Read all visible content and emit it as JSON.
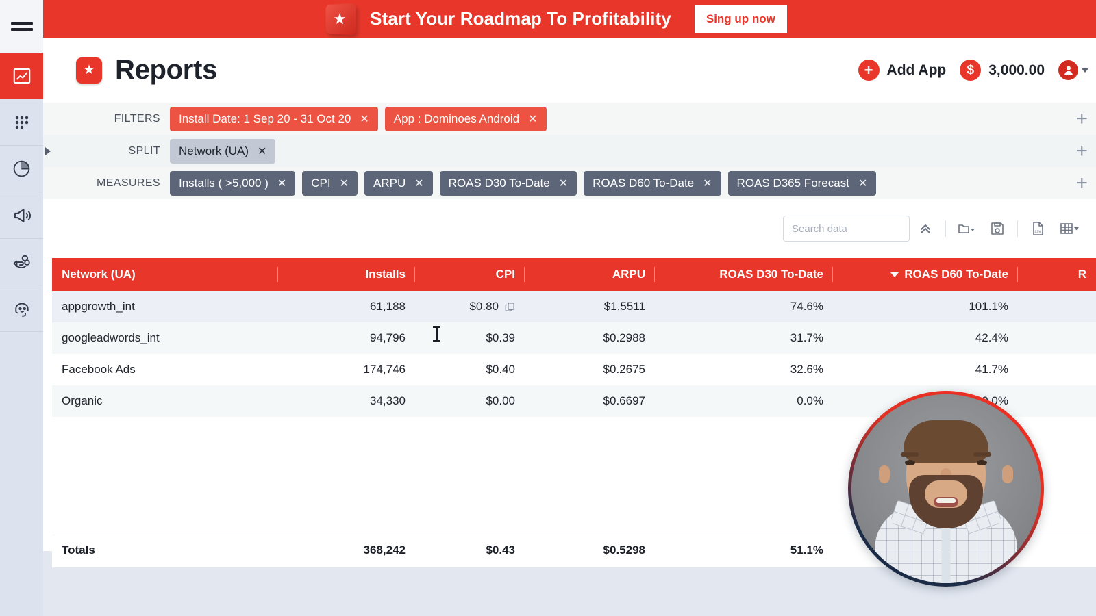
{
  "promo": {
    "text": "Start Your Roadmap To Profitability",
    "button": "Sing up now",
    "logo_icon": "star-icon"
  },
  "sidebar": {
    "menu_icon": "hamburger-icon",
    "items": [
      {
        "name": "reports",
        "icon": "line-chart-icon",
        "active": true
      },
      {
        "name": "apps",
        "icon": "grid-dots-icon",
        "active": false
      },
      {
        "name": "analytics",
        "icon": "pie-chart-icon",
        "active": false
      },
      {
        "name": "campaigns",
        "icon": "megaphone-icon",
        "active": false
      },
      {
        "name": "payouts",
        "icon": "hand-coin-icon",
        "active": false
      },
      {
        "name": "support",
        "icon": "headset-icon",
        "active": false
      }
    ]
  },
  "header": {
    "title": "Reports",
    "logo_icon": "star-icon",
    "add_app_label": "Add App",
    "add_app_icon": "plus-circle-icon",
    "balance": "3,000.00",
    "balance_icon": "dollar-circle-icon",
    "avatar_icon": "user-avatar-icon",
    "avatar_caret": "chevron-down-icon"
  },
  "filters": {
    "rows": [
      {
        "label": "FILTERS",
        "style": "red",
        "chips": [
          {
            "label": "Install Date: 1 Sep 20 - 31 Oct 20",
            "remove": "✕"
          },
          {
            "label": "App : Dominoes Android",
            "remove": "✕"
          }
        ],
        "add": "+"
      },
      {
        "label": "SPLIT",
        "style": "grey",
        "chips": [
          {
            "label": "Network (UA)",
            "remove": "✕"
          }
        ],
        "add": "+"
      },
      {
        "label": "MEASURES",
        "style": "slate",
        "chips": [
          {
            "label": "Installs ( >5,000 )",
            "remove": "✕"
          },
          {
            "label": "CPI",
            "remove": "✕"
          },
          {
            "label": "ARPU",
            "remove": "✕"
          },
          {
            "label": "ROAS D30 To-Date",
            "remove": "✕"
          },
          {
            "label": "ROAS D60 To-Date",
            "remove": "✕"
          },
          {
            "label": "ROAS D365 Forecast",
            "remove": "✕"
          }
        ],
        "add": "+"
      }
    ]
  },
  "toolbar": {
    "search_placeholder": "Search data",
    "search_value": "",
    "icons": [
      {
        "name": "collapse-up-icon"
      },
      {
        "name": "folder-dropdown-icon"
      },
      {
        "name": "save-icon"
      },
      {
        "name": "csv-export-icon"
      },
      {
        "name": "table-view-dropdown-icon"
      }
    ]
  },
  "table": {
    "columns": [
      {
        "key": "network",
        "label": "Network (UA)",
        "align": "left",
        "sorted": false
      },
      {
        "key": "installs",
        "label": "Installs",
        "align": "right",
        "sorted": false
      },
      {
        "key": "cpi",
        "label": "CPI",
        "align": "right",
        "sorted": false
      },
      {
        "key": "arpu",
        "label": "ARPU",
        "align": "right",
        "sorted": false
      },
      {
        "key": "roas_d30",
        "label": "ROAS D30 To-Date",
        "align": "right",
        "sorted": false
      },
      {
        "key": "roas_d60",
        "label": "ROAS D60 To-Date",
        "align": "right",
        "sorted": true,
        "sort_dir": "desc"
      },
      {
        "key": "roas_d365",
        "label": "R",
        "align": "right",
        "sorted": false
      }
    ],
    "rows": [
      {
        "network": "appgrowth_int",
        "installs": "61,188",
        "cpi": "$0.80",
        "arpu": "$1.5511",
        "roas_d30": "74.6%",
        "roas_d60": "101.1%",
        "roas_d365": "",
        "hovered": true
      },
      {
        "network": "googleadwords_int",
        "installs": "94,796",
        "cpi": "$0.39",
        "arpu": "$0.2988",
        "roas_d30": "31.7%",
        "roas_d60": "42.4%",
        "roas_d365": "",
        "hovered": false
      },
      {
        "network": "Facebook Ads",
        "installs": "174,746",
        "cpi": "$0.40",
        "arpu": "$0.2675",
        "roas_d30": "32.6%",
        "roas_d60": "41.7%",
        "roas_d365": "",
        "hovered": false
      },
      {
        "network": "Organic",
        "installs": "34,330",
        "cpi": "$0.00",
        "arpu": "$0.6697",
        "roas_d30": "0.0%",
        "roas_d60": "0.0%",
        "roas_d365": "",
        "hovered": false
      }
    ],
    "totals": {
      "network": "Totals",
      "installs": "368,242",
      "cpi": "$0.43",
      "arpu": "$0.5298",
      "roas_d30": "51.1%",
      "roas_d60": "",
      "roas_d365": ""
    },
    "copy_icon": "copy-icon"
  },
  "overlay": {
    "video_bubble": "presenter-video-bubble",
    "cursor": "text-cursor"
  }
}
